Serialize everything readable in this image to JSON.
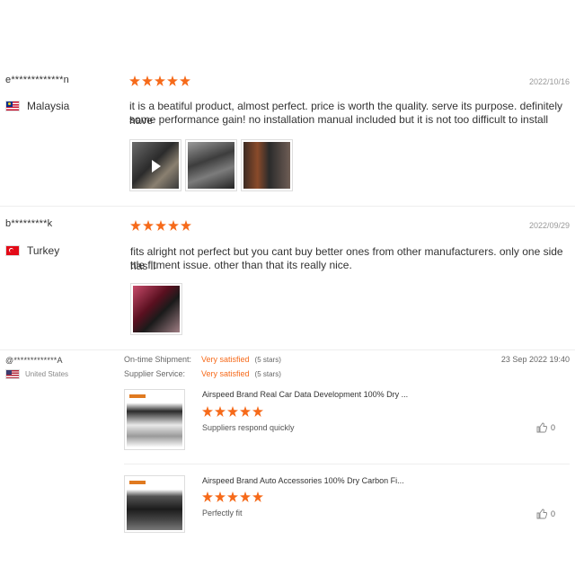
{
  "reviews": [
    {
      "user": "e*************n",
      "country": "Malaysia",
      "date": "2022/10/16",
      "stars": 5,
      "text_line1": "it is a beatiful product, almost perfect. price is worth the quality. serve its purpose. definitely have",
      "text_line2": "some performance gain! no installation manual included but it is not too difficult to install"
    },
    {
      "user": "b*********k",
      "country": "Turkey",
      "date": "2022/09/29",
      "stars": 5,
      "text_line1": "fits alright not perfect but you cant buy better ones from other manufacturers. only one side has li",
      "text_line2": "ttle fitment issue. other than that its really nice."
    }
  ],
  "supplier_review": {
    "user": "@*************A",
    "country": "United States",
    "date": "23 Sep 2022 19:40",
    "shipment_label": "On-time Shipment:",
    "shipment_value": "Very satisfied",
    "shipment_stars": "(5 stars)",
    "service_label": "Supplier Service:",
    "service_value": "Very satisfied",
    "service_stars": "(5 stars)",
    "products": [
      {
        "title": "Airspeed Brand Real Car Data Development 100% Dry ...",
        "stars": 5,
        "comment": "Suppliers respond quickly",
        "likes": "0"
      },
      {
        "title": "Airspeed Brand Auto Accessories 100% Dry Carbon Fi...",
        "stars": 5,
        "comment": "Perfectly fit",
        "likes": "0"
      }
    ]
  },
  "colors": {
    "star": "#f66a1a",
    "accent": "#f66a1a"
  }
}
